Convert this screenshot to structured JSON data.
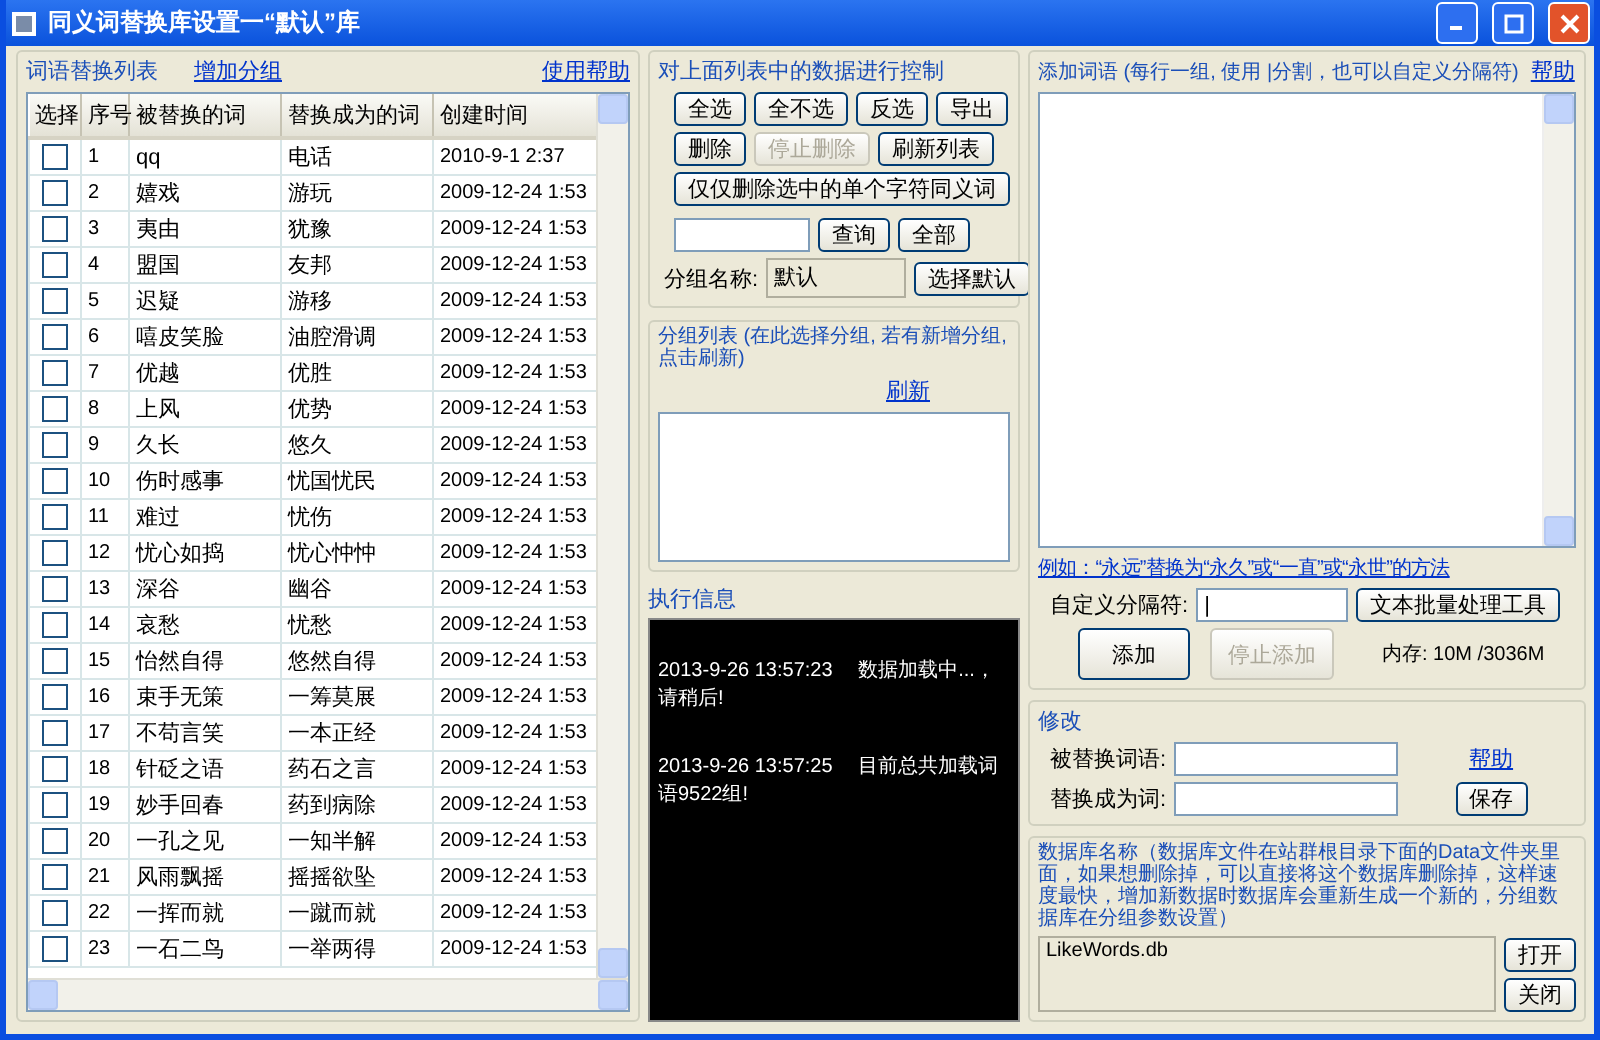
{
  "window": {
    "title": "同义词替换库设置一“默认”库"
  },
  "word_list": {
    "title": "词语替换列表",
    "add_group_link": "增加分组",
    "help_link": "使用帮助",
    "columns": [
      "选择",
      "序号",
      "被替换的词",
      "替换成为的词",
      "创建时间"
    ],
    "rows": [
      {
        "checked": false,
        "index": "1",
        "word": "qq",
        "replacement": "电话",
        "created": "2010-9-1 2:37"
      },
      {
        "checked": false,
        "index": "2",
        "word": "嬉戏",
        "replacement": "游玩",
        "created": "2009-12-24 1:53"
      },
      {
        "checked": false,
        "index": "3",
        "word": "夷由",
        "replacement": "犹豫",
        "created": "2009-12-24 1:53"
      },
      {
        "checked": false,
        "index": "4",
        "word": "盟国",
        "replacement": "友邦",
        "created": "2009-12-24 1:53"
      },
      {
        "checked": false,
        "index": "5",
        "word": "迟疑",
        "replacement": "游移",
        "created": "2009-12-24 1:53"
      },
      {
        "checked": false,
        "index": "6",
        "word": "嘻皮笑脸",
        "replacement": "油腔滑调",
        "created": "2009-12-24 1:53"
      },
      {
        "checked": false,
        "index": "7",
        "word": "优越",
        "replacement": "优胜",
        "created": "2009-12-24 1:53"
      },
      {
        "checked": false,
        "index": "8",
        "word": "上风",
        "replacement": "优势",
        "created": "2009-12-24 1:53"
      },
      {
        "checked": false,
        "index": "9",
        "word": "久长",
        "replacement": "悠久",
        "created": "2009-12-24 1:53"
      },
      {
        "checked": false,
        "index": "10",
        "word": "伤时感事",
        "replacement": "忧国忧民",
        "created": "2009-12-24 1:53"
      },
      {
        "checked": false,
        "index": "11",
        "word": "难过",
        "replacement": "忧伤",
        "created": "2009-12-24 1:53"
      },
      {
        "checked": false,
        "index": "12",
        "word": "忧心如捣",
        "replacement": "忧心忡忡",
        "created": "2009-12-24 1:53"
      },
      {
        "checked": false,
        "index": "13",
        "word": "深谷",
        "replacement": "幽谷",
        "created": "2009-12-24 1:53"
      },
      {
        "checked": false,
        "index": "14",
        "word": "哀愁",
        "replacement": "忧愁",
        "created": "2009-12-24 1:53"
      },
      {
        "checked": false,
        "index": "15",
        "word": "怡然自得",
        "replacement": "悠然自得",
        "created": "2009-12-24 1:53"
      },
      {
        "checked": false,
        "index": "16",
        "word": "束手无策",
        "replacement": "一筹莫展",
        "created": "2009-12-24 1:53"
      },
      {
        "checked": false,
        "index": "17",
        "word": "不苟言笑",
        "replacement": "一本正经",
        "created": "2009-12-24 1:53"
      },
      {
        "checked": false,
        "index": "18",
        "word": "针砭之语",
        "replacement": "药石之言",
        "created": "2009-12-24 1:53"
      },
      {
        "checked": false,
        "index": "19",
        "word": "妙手回春",
        "replacement": "药到病除",
        "created": "2009-12-24 1:53"
      },
      {
        "checked": false,
        "index": "20",
        "word": "一孔之见",
        "replacement": "一知半解",
        "created": "2009-12-24 1:53"
      },
      {
        "checked": false,
        "index": "21",
        "word": "风雨飘摇",
        "replacement": "摇摇欲坠",
        "created": "2009-12-24 1:53"
      },
      {
        "checked": false,
        "index": "22",
        "word": "一挥而就",
        "replacement": "一蹴而就",
        "created": "2009-12-24 1:53"
      },
      {
        "checked": false,
        "index": "23",
        "word": "一石二鸟",
        "replacement": "一举两得",
        "created": "2009-12-24 1:53"
      }
    ]
  },
  "controls": {
    "title": "对上面列表中的数据进行控制",
    "buttons": [
      {
        "label": "全选",
        "disabled": false
      },
      {
        "label": "全不选",
        "disabled": false
      },
      {
        "label": "反选",
        "disabled": false
      },
      {
        "label": "导出",
        "disabled": false
      },
      {
        "label": "删除",
        "disabled": false
      },
      {
        "label": "停止删除",
        "disabled": true
      },
      {
        "label": "刷新列表",
        "disabled": false
      }
    ],
    "delete_single_button": "仅仅删除选中的单个字符同义词",
    "query_button": "查询",
    "all_button": "全部",
    "group_name_label": "分组名称:",
    "group_name_value": "默认",
    "select_default_button": "选择默认"
  },
  "group_list": {
    "title": "分组列表 (在此选择分组, 若有新增分组, 点击刷新)",
    "refresh_link": "刷新"
  },
  "log": {
    "title": "执行信息",
    "entries": [
      "2013-9-26 13:57:23　 数据加载中...，请稍后!",
      "2013-9-26 13:57:25　 目前总共加载词语9522组!"
    ]
  },
  "add_words": {
    "title": "添加词语 (每行一组, 使用 |分割，也可以自定义分隔符)",
    "help_link": "帮助",
    "example_link": "例如：“永远”替换为“永久”或“一直”或“永世”的方法",
    "separator_label": "自定义分隔符:",
    "separator_value": "|",
    "batch_tool_button": "文本批量处理工具",
    "buttons": [
      {
        "label": "添加",
        "disabled": false
      },
      {
        "label": "停止添加",
        "disabled": true
      }
    ],
    "memory": "内存: 10M /3036M"
  },
  "modify": {
    "title": "修改",
    "replaced_label": "被替换词语:",
    "replacement_label": "替换成为词:",
    "help_link": "帮助",
    "save_button": "保存"
  },
  "database": {
    "description": "数据库名称（数据库文件在站群根目录下面的Data文件夹里面，如果想删除掉，可以直接将这个数据库删除掉，这样速度最快，增加新数据时数据库会重新生成一个新的，分组数据库在分组参数设置）",
    "value": "LikeWords.db",
    "open_button": "打开",
    "close_button": "关闭"
  }
}
